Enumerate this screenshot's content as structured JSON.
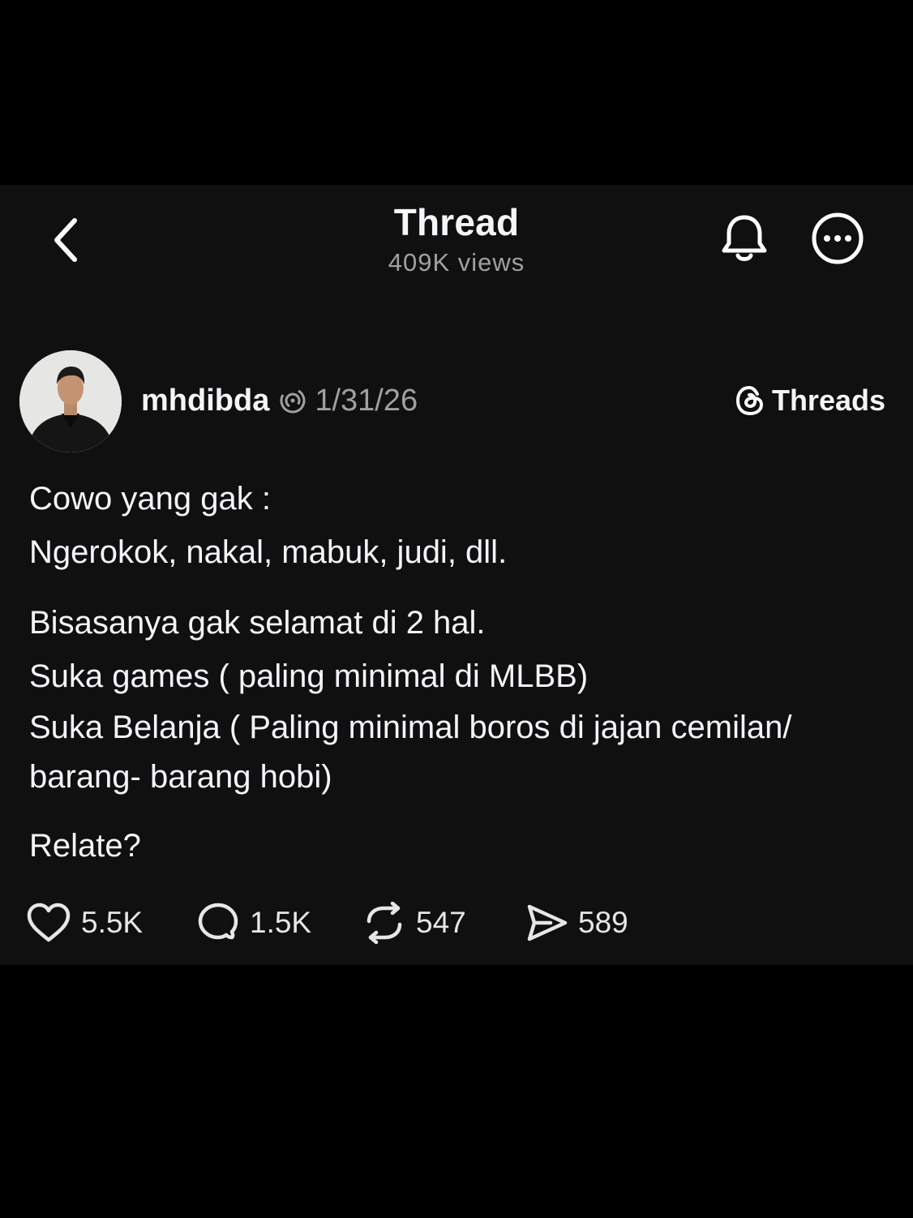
{
  "header": {
    "title": "Thread",
    "views": "409K views",
    "back_icon": "chevron-left-icon",
    "bell_icon": "bell-icon",
    "more_icon": "more-options-icon"
  },
  "post": {
    "username": "mhdibda",
    "date": "1/31/26",
    "source_badge": "Threads",
    "lines": {
      "l1": "Cowo yang gak :",
      "l2": "Ngerokok, nakal, mabuk, judi, dll.",
      "l3": "Bisasanya gak selamat di 2 hal.",
      "l4": "Suka games ( paling minimal di MLBB)",
      "l5": "Suka Belanja ( Paling minimal boros di jajan cemilan/",
      "l6": "barang- barang hobi)",
      "l7": "Relate?"
    }
  },
  "actions": {
    "likes": "5.5K",
    "comments": "1.5K",
    "reposts": "547",
    "shares": "589"
  },
  "colors": {
    "background": "#000000",
    "card": "#101010",
    "text": "#f3f5f7",
    "muted": "#a0a0a0"
  }
}
